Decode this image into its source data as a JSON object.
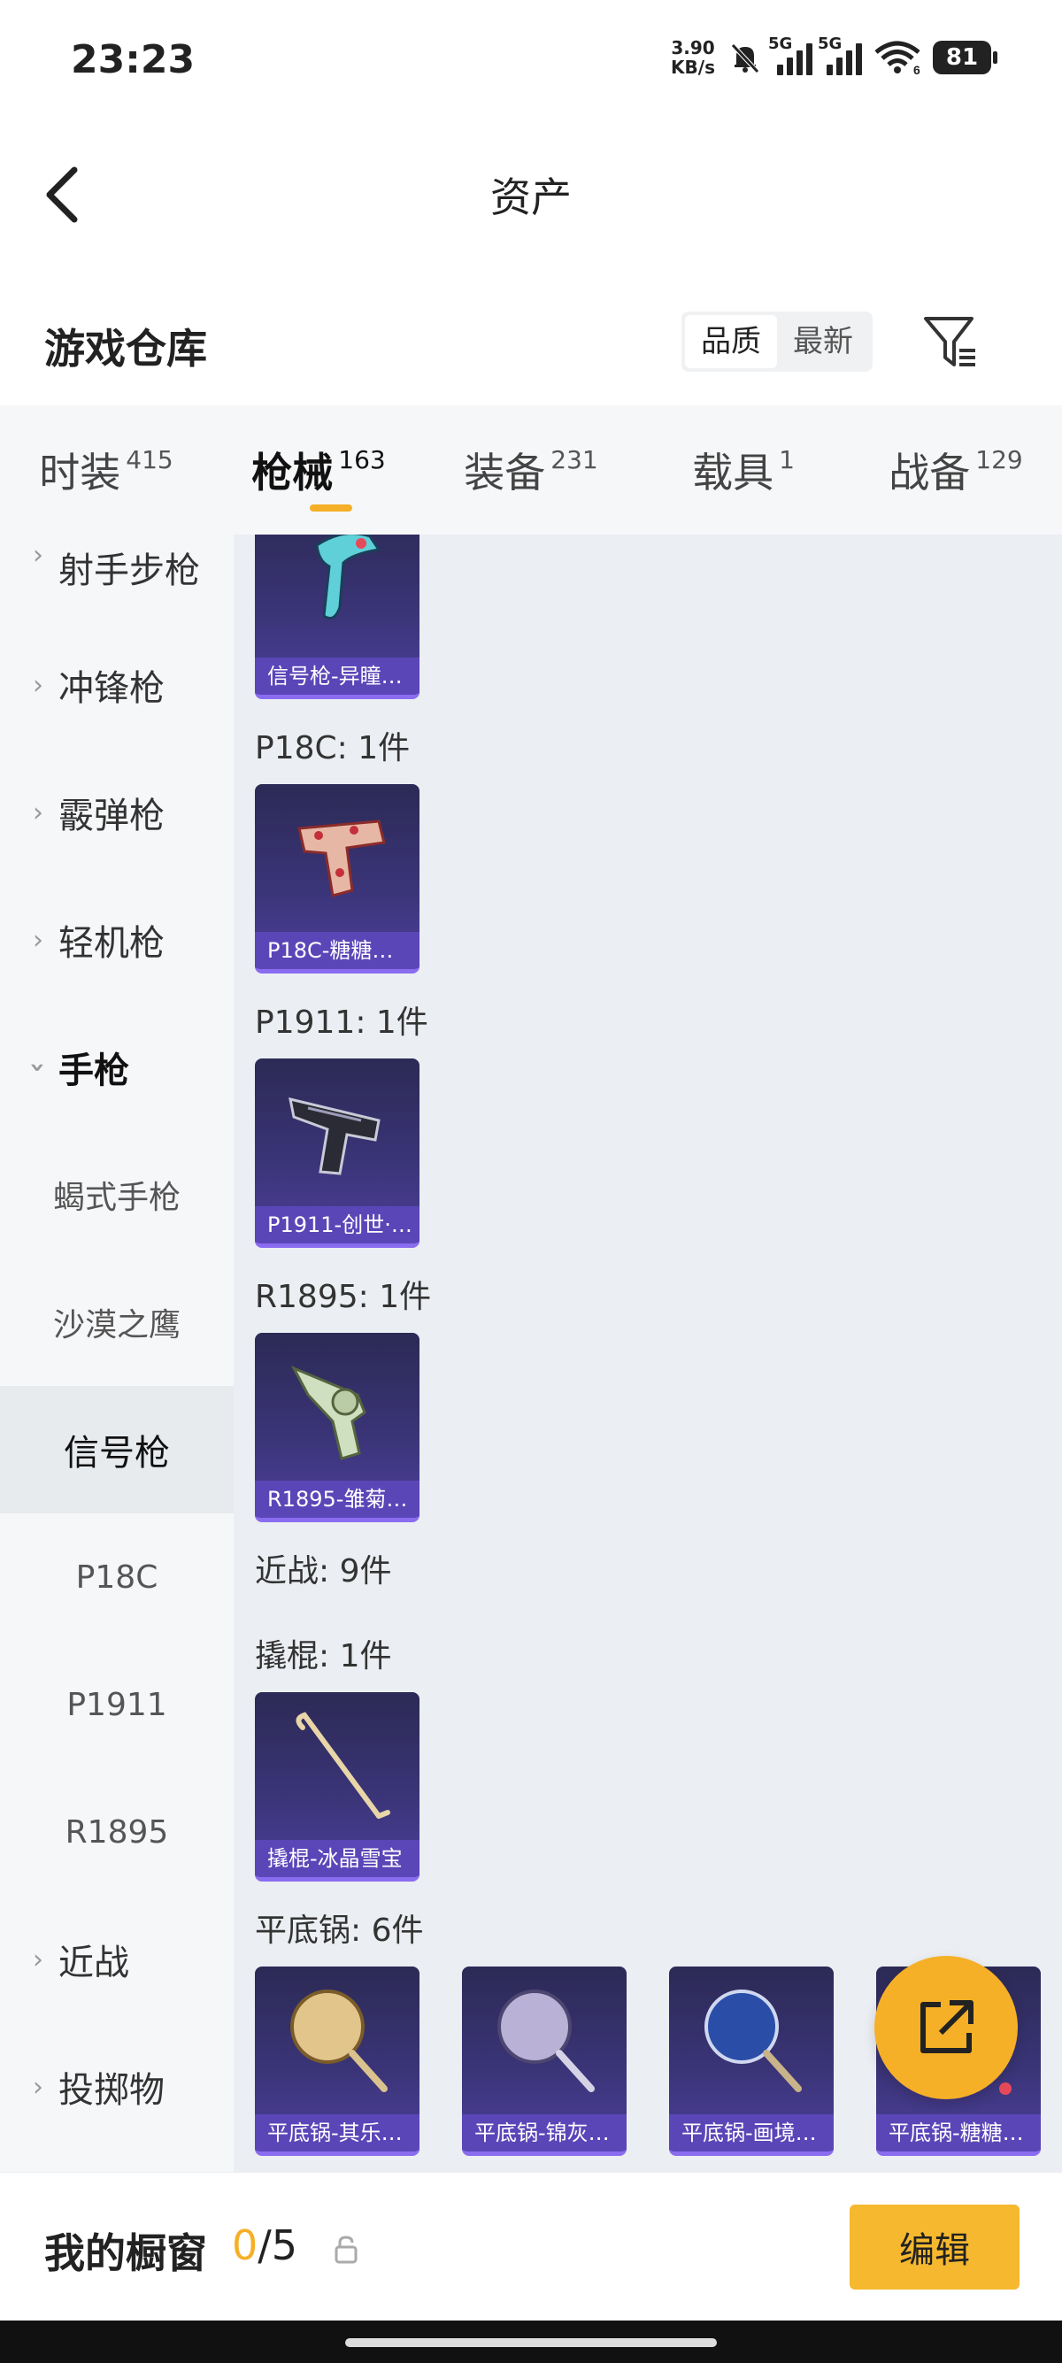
{
  "status_bar": {
    "time": "23:23",
    "net_speed_value": "3.90",
    "net_speed_unit": "KB/s",
    "signal_1_tag": "5G",
    "signal_2_tag": "5G",
    "wifi_tag": "6",
    "battery": "81"
  },
  "header": {
    "title": "资产"
  },
  "warehouse": {
    "title": "游戏仓库",
    "sort_options": [
      "品质",
      "最新"
    ],
    "active_sort": "品质"
  },
  "tabs": [
    {
      "label": "时装",
      "count": "415"
    },
    {
      "label": "枪械",
      "count": "163",
      "active": true
    },
    {
      "label": "装备",
      "count": "231"
    },
    {
      "label": "载具",
      "count": "1"
    },
    {
      "label": "战备",
      "count": "129"
    }
  ],
  "sidebar": [
    {
      "label": "射手步枪",
      "type": "group"
    },
    {
      "label": "冲锋枪",
      "type": "group"
    },
    {
      "label": "霰弹枪",
      "type": "group"
    },
    {
      "label": "轻机枪",
      "type": "group"
    },
    {
      "label": "手枪",
      "type": "group-open"
    },
    {
      "label": "蝎式手枪",
      "type": "sub"
    },
    {
      "label": "沙漠之鹰",
      "type": "sub"
    },
    {
      "label": "信号枪",
      "type": "sub-selected"
    },
    {
      "label": "P18C",
      "type": "sub"
    },
    {
      "label": "P1911",
      "type": "sub"
    },
    {
      "label": "R1895",
      "type": "sub"
    },
    {
      "label": "近战",
      "type": "group"
    },
    {
      "label": "投掷物",
      "type": "group"
    }
  ],
  "content": {
    "sections": [
      {
        "label": "",
        "items": [
          "信号枪-异瞳…"
        ]
      },
      {
        "label": "P18C: 1件",
        "items": [
          "P18C-糖糖…"
        ]
      },
      {
        "label": "P1911: 1件",
        "items": [
          "P1911-创世·…"
        ]
      },
      {
        "label": "R1895: 1件",
        "items": [
          "R1895-雏菊…"
        ]
      },
      {
        "label": "近战: 9件",
        "items": []
      },
      {
        "label": "撬棍: 1件",
        "items": [
          "撬棍-冰晶雪宝"
        ]
      },
      {
        "label": "平底锅: 6件",
        "items": [
          "平底锅-其乐…",
          "平底锅-锦灰…",
          "平底锅-画境…",
          "平底锅-糖糖…"
        ]
      }
    ]
  },
  "bottom": {
    "showcase_label": "我的橱窗",
    "showcase_current": "0",
    "showcase_sep_total": "/5",
    "edit_label": "编辑"
  },
  "colors": {
    "accent": "#f5b027",
    "card_bg": "#3a3477",
    "card_label": "#5b46b8",
    "content_bg": "#ebeef2",
    "sidebar_bg": "#f6f7f9"
  }
}
